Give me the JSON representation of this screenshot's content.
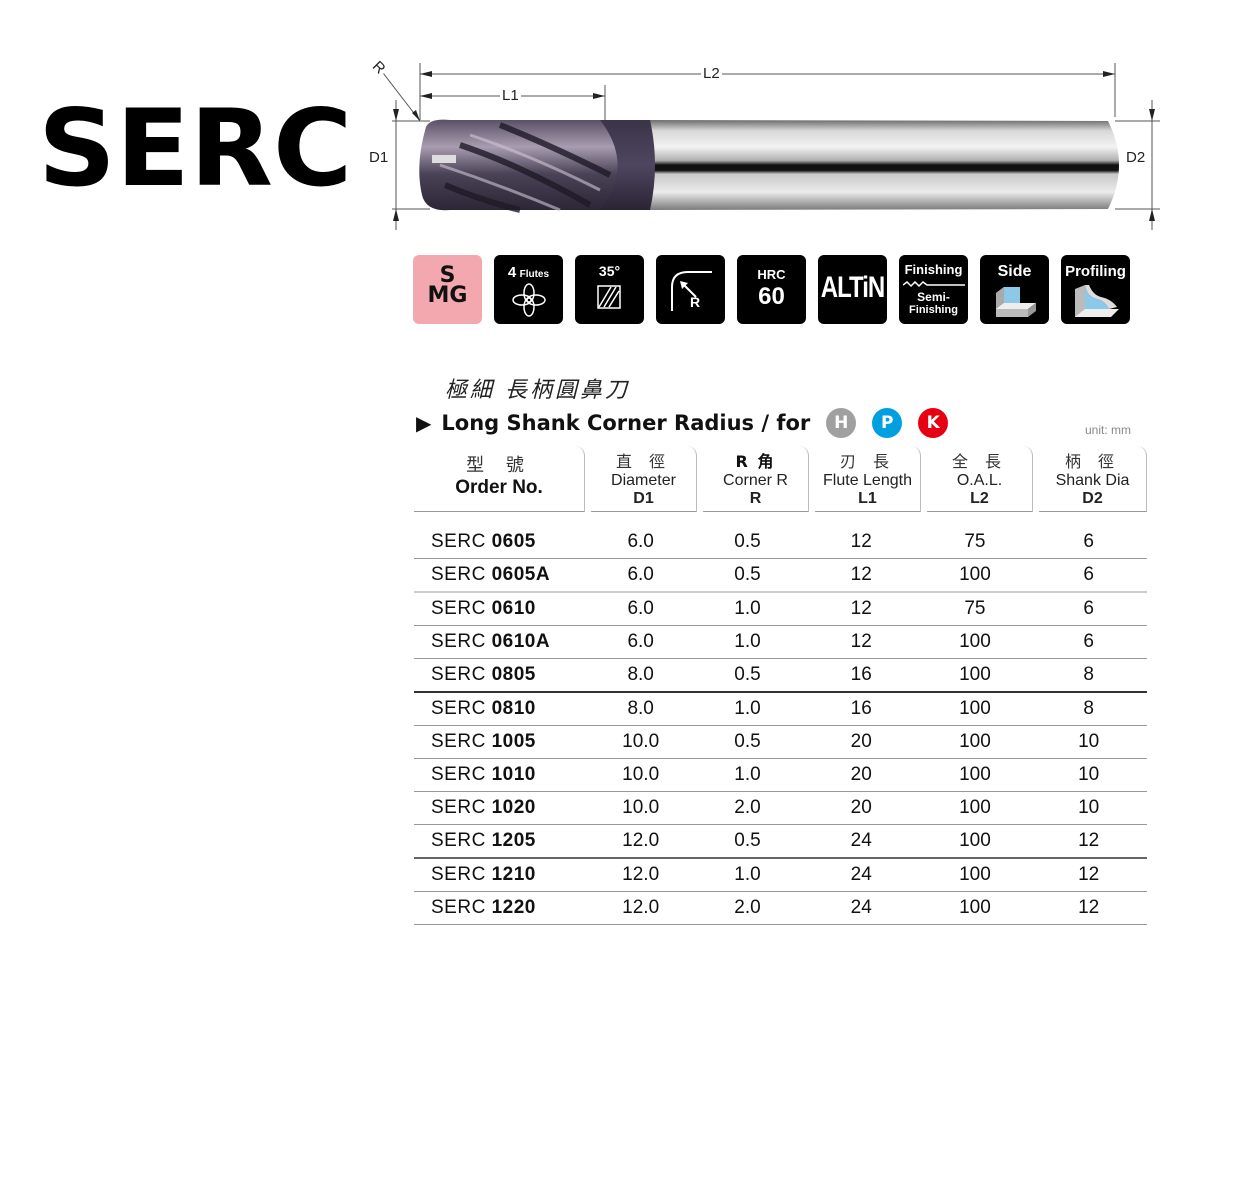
{
  "title": "SERC",
  "drawing": {
    "labels": {
      "r": "R",
      "l1": "L1",
      "l2": "L2",
      "d1": "D1",
      "d2": "D2"
    }
  },
  "icons": [
    {
      "name": "material-smg-icon",
      "line1": "S",
      "line2": "MG",
      "color": "#f2a8ae"
    },
    {
      "name": "flutes-icon",
      "line1": "4",
      "line2": "Flutes"
    },
    {
      "name": "helix-angle-icon",
      "line1": "35°"
    },
    {
      "name": "corner-radius-icon",
      "line1": "R"
    },
    {
      "name": "hardness-icon",
      "line1": "HRC",
      "line2": "60"
    },
    {
      "name": "coating-icon",
      "line1": "ALTiN"
    },
    {
      "name": "finishing-icon",
      "line1": "Finishing",
      "line2": "Semi-",
      "line3": "Finishing"
    },
    {
      "name": "side-milling-icon",
      "line1": "Side"
    },
    {
      "name": "profiling-icon",
      "line1": "Profiling"
    }
  ],
  "heading": {
    "cn": "極細 長柄圓鼻刀",
    "en": "Long Shank Corner Radius / for",
    "materials": [
      {
        "label": "H",
        "color": "#a0a0a0"
      },
      {
        "label": "P",
        "color": "#00a0e0"
      },
      {
        "label": "K",
        "color": "#e60012"
      }
    ],
    "unit": "unit: mm"
  },
  "table": {
    "columns": [
      {
        "cn": "型 號",
        "en": "Order No.",
        "sym": ""
      },
      {
        "cn": "直 徑",
        "en": "Diameter",
        "sym": "D1"
      },
      {
        "cn": "R 角",
        "en": "Corner R",
        "sym": "R"
      },
      {
        "cn": "刃 長",
        "en": "Flute Length",
        "sym": "L1"
      },
      {
        "cn": "全 長",
        "en": "O.A.L.",
        "sym": "L2"
      },
      {
        "cn": "柄 徑",
        "en": "Shank Dia",
        "sym": "D2"
      }
    ],
    "rows": [
      {
        "prefix": "SERC",
        "code": "0605",
        "d1": "6.0",
        "r": "0.5",
        "l1": "12",
        "l2": "75",
        "d2": "6"
      },
      {
        "prefix": "SERC",
        "code": "0605A",
        "d1": "6.0",
        "r": "0.5",
        "l1": "12",
        "l2": "100",
        "d2": "6"
      },
      {
        "prefix": "SERC",
        "code": "0610",
        "d1": "6.0",
        "r": "1.0",
        "l1": "12",
        "l2": "75",
        "d2": "6"
      },
      {
        "prefix": "SERC",
        "code": "0610A",
        "d1": "6.0",
        "r": "1.0",
        "l1": "12",
        "l2": "100",
        "d2": "6"
      },
      {
        "prefix": "SERC",
        "code": "0805",
        "d1": "8.0",
        "r": "0.5",
        "l1": "16",
        "l2": "100",
        "d2": "8"
      },
      {
        "prefix": "SERC",
        "code": "0810",
        "d1": "8.0",
        "r": "1.0",
        "l1": "16",
        "l2": "100",
        "d2": "8"
      },
      {
        "prefix": "SERC",
        "code": "1005",
        "d1": "10.0",
        "r": "0.5",
        "l1": "20",
        "l2": "100",
        "d2": "10"
      },
      {
        "prefix": "SERC",
        "code": "1010",
        "d1": "10.0",
        "r": "1.0",
        "l1": "20",
        "l2": "100",
        "d2": "10"
      },
      {
        "prefix": "SERC",
        "code": "1020",
        "d1": "10.0",
        "r": "2.0",
        "l1": "20",
        "l2": "100",
        "d2": "10"
      },
      {
        "prefix": "SERC",
        "code": "1205",
        "d1": "12.0",
        "r": "0.5",
        "l1": "24",
        "l2": "100",
        "d2": "12"
      },
      {
        "prefix": "SERC",
        "code": "1210",
        "d1": "12.0",
        "r": "1.0",
        "l1": "24",
        "l2": "100",
        "d2": "12"
      },
      {
        "prefix": "SERC",
        "code": "1220",
        "d1": "12.0",
        "r": "2.0",
        "l1": "24",
        "l2": "100",
        "d2": "12"
      }
    ]
  }
}
